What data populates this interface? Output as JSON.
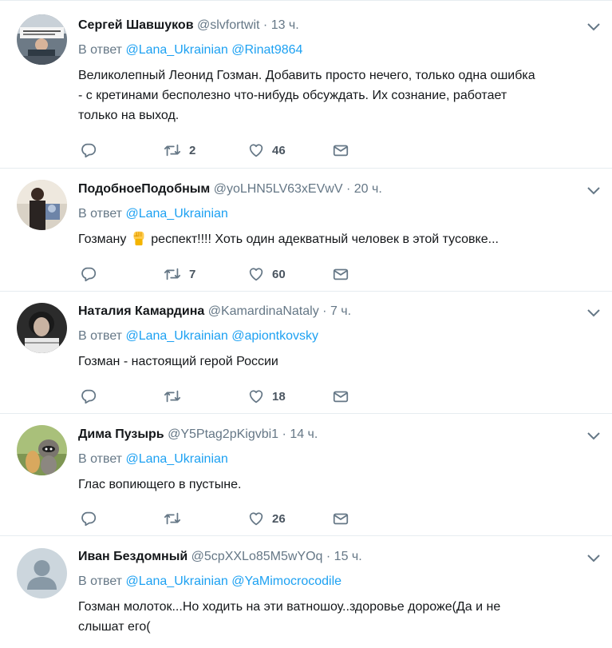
{
  "colors": {
    "accent": "#1da1f2",
    "secondary_text": "#657786",
    "divider": "#e6ecf0"
  },
  "icons": {
    "reply": "reply-icon",
    "retweet": "retweet-icon",
    "like": "heart-icon",
    "dm": "envelope-icon",
    "menu": "chevron-down-icon",
    "emoji": "raised-fist-emoji-icon"
  },
  "tweets": [
    {
      "name": "Сергей Шавшуков",
      "handle": "@slvfortwit",
      "dot": "·",
      "time": "13 ч.",
      "reply_prefix": "В ответ",
      "mentions": [
        "@Lana_Ukrainian",
        "@Rinat9864"
      ],
      "text_lines": [
        "Великолепный Леонид Гозман. Добавить просто нечего, только одна ошибка",
        "- с кретинами бесполезно что-нибудь обсуждать. Их сознание, работает",
        "только на выход."
      ],
      "retweets": "2",
      "likes": "46"
    },
    {
      "name": "ПодобноеПодобным",
      "handle": "@yoLHN5LV63xEVwV",
      "dot": "·",
      "time": "20 ч.",
      "reply_prefix": "В ответ",
      "mentions": [
        "@Lana_Ukrainian"
      ],
      "text_before_emoji": "Гозману ",
      "text_after_emoji": " респект!!!! Хоть один адекватный человек в этой тусовке...",
      "retweets": "7",
      "likes": "60"
    },
    {
      "name": "Наталия Камардина",
      "handle": "@KamardinaNataly",
      "dot": "·",
      "time": "7 ч.",
      "reply_prefix": "В ответ",
      "mentions": [
        "@Lana_Ukrainian",
        "@apiontkovsky"
      ],
      "text_lines": [
        "Гозман - настоящий герой России"
      ],
      "likes": "18"
    },
    {
      "name": "Дима Пузырь",
      "handle": "@Y5Ptag2pKigvbi1",
      "dot": "·",
      "time": "14 ч.",
      "reply_prefix": "В ответ",
      "mentions": [
        "@Lana_Ukrainian"
      ],
      "text_lines": [
        "Глас вопиющего в пустыне."
      ],
      "likes": "26"
    },
    {
      "name": "Иван Бездомный",
      "handle": "@5cpXXLo85M5wYOq",
      "dot": "·",
      "time": "15 ч.",
      "reply_prefix": "В ответ",
      "mentions": [
        "@Lana_Ukrainian",
        "@YaMimocrocodile"
      ],
      "text_lines": [
        "Гозман молоток...Но ходить на эти ватношоу..здоровье дороже(Да  и не",
        "слышат его("
      ]
    }
  ]
}
